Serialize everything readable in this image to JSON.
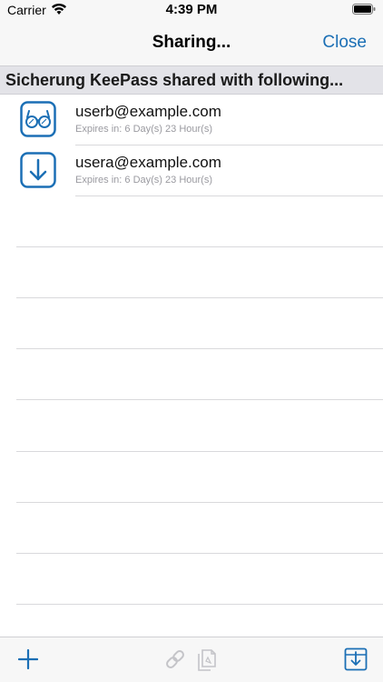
{
  "status_bar": {
    "carrier": "Carrier",
    "time": "4:39 PM"
  },
  "nav": {
    "title": "Sharing...",
    "close_label": "Close"
  },
  "section": {
    "header": "Sicherung KeePass shared with following..."
  },
  "shares": [
    {
      "email": "userb@example.com",
      "expires": "Expires in: 6 Day(s) 23 Hour(s)",
      "icon": "glasses-icon"
    },
    {
      "email": "usera@example.com",
      "expires": "Expires in: 6 Day(s) 23 Hour(s)",
      "icon": "download-arrow-icon"
    }
  ],
  "toolbar": {
    "icons": [
      "plus-icon",
      "link-icon",
      "copy-document-icon",
      "import-icon"
    ]
  },
  "colors": {
    "accent": "#1b6fb5",
    "disabled": "#c4c4c8",
    "header_bg": "#e3e3e8",
    "bar_bg": "#f7f7f7"
  }
}
